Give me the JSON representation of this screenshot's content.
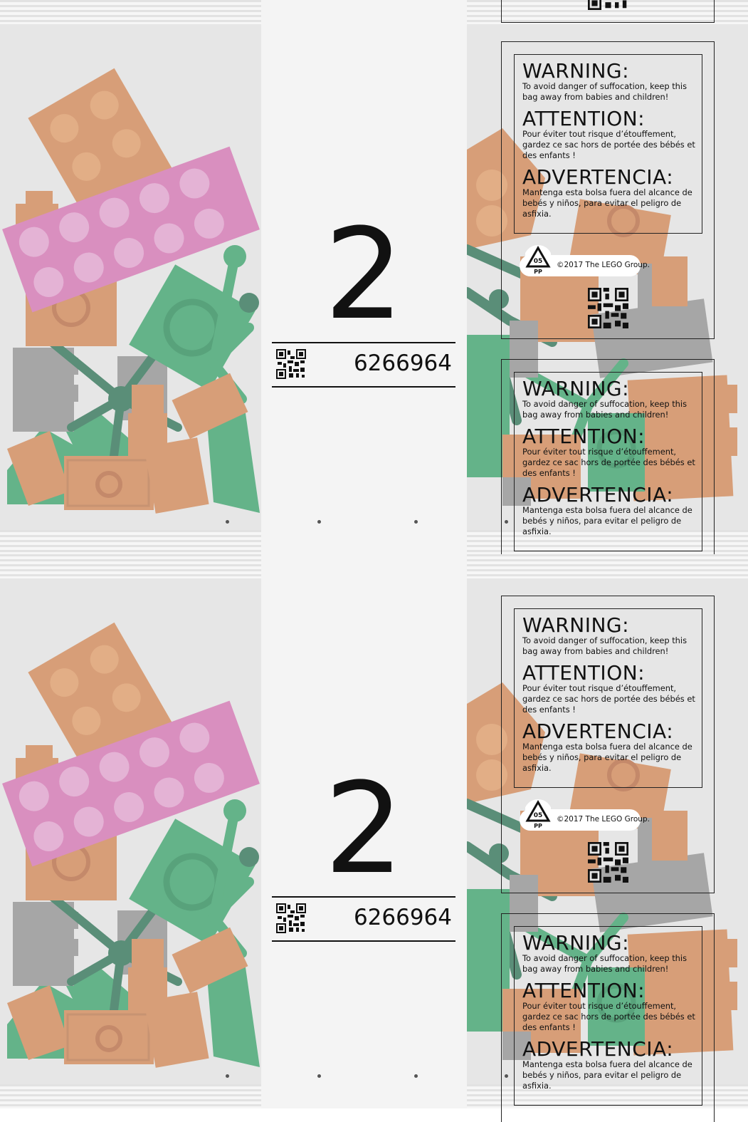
{
  "bag_number": "2",
  "element_code": "6266964",
  "warnings": [
    {
      "title": "WARNING:",
      "text": "To avoid danger of suffocation, keep this bag away from babies and children!"
    },
    {
      "title": "ATTENTION:",
      "text": "Pour éviter tout risque d’étouffement, gardez ce sac hors de portée des bébés et des enfants !"
    },
    {
      "title": "ADVERTENCIA:",
      "text": "Mantenga esta bolsa fuera del alcance de bebés y niños, para evitar el peligro de asfixia."
    }
  ],
  "recycle_code": "05",
  "recycle_material": "PP",
  "copyright": "©2017 The LEGO Group.",
  "colors": {
    "bag_background": "#e6e6e6",
    "center_panel": "#f4f4f4",
    "brick_tan": "#d79e78",
    "brick_pink": "#d98fbf",
    "brick_green": "#64b389",
    "brick_dark_green": "#5a8e78",
    "brick_grey": "#a6a6a6"
  }
}
